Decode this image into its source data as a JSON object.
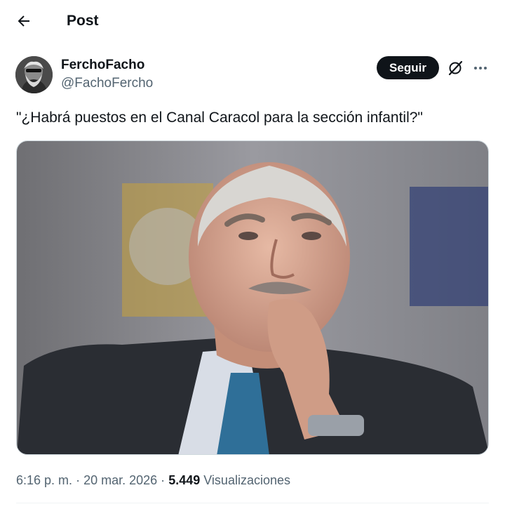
{
  "header": {
    "title": "Post",
    "back_icon": "arrow-left-icon"
  },
  "author": {
    "name": "FerchoFacho",
    "handle": "@FachoFercho",
    "follow_label": "Seguir",
    "grok_icon": "grok-icon",
    "more_icon": "more-horizontal-icon"
  },
  "tweet": {
    "text": "\"¿Habrá puestos en el Canal Caracol para la sección infantil?\""
  },
  "meta": {
    "time": "6:16 p. m.",
    "separator": "·",
    "date": "20 mar. 2026",
    "views_count": "5.449",
    "views_label": "Visualizaciones"
  },
  "colors": {
    "text_primary": "#0f1419",
    "text_secondary": "#536471",
    "follow_bg": "#0f1419",
    "border": "#cfd9de"
  }
}
